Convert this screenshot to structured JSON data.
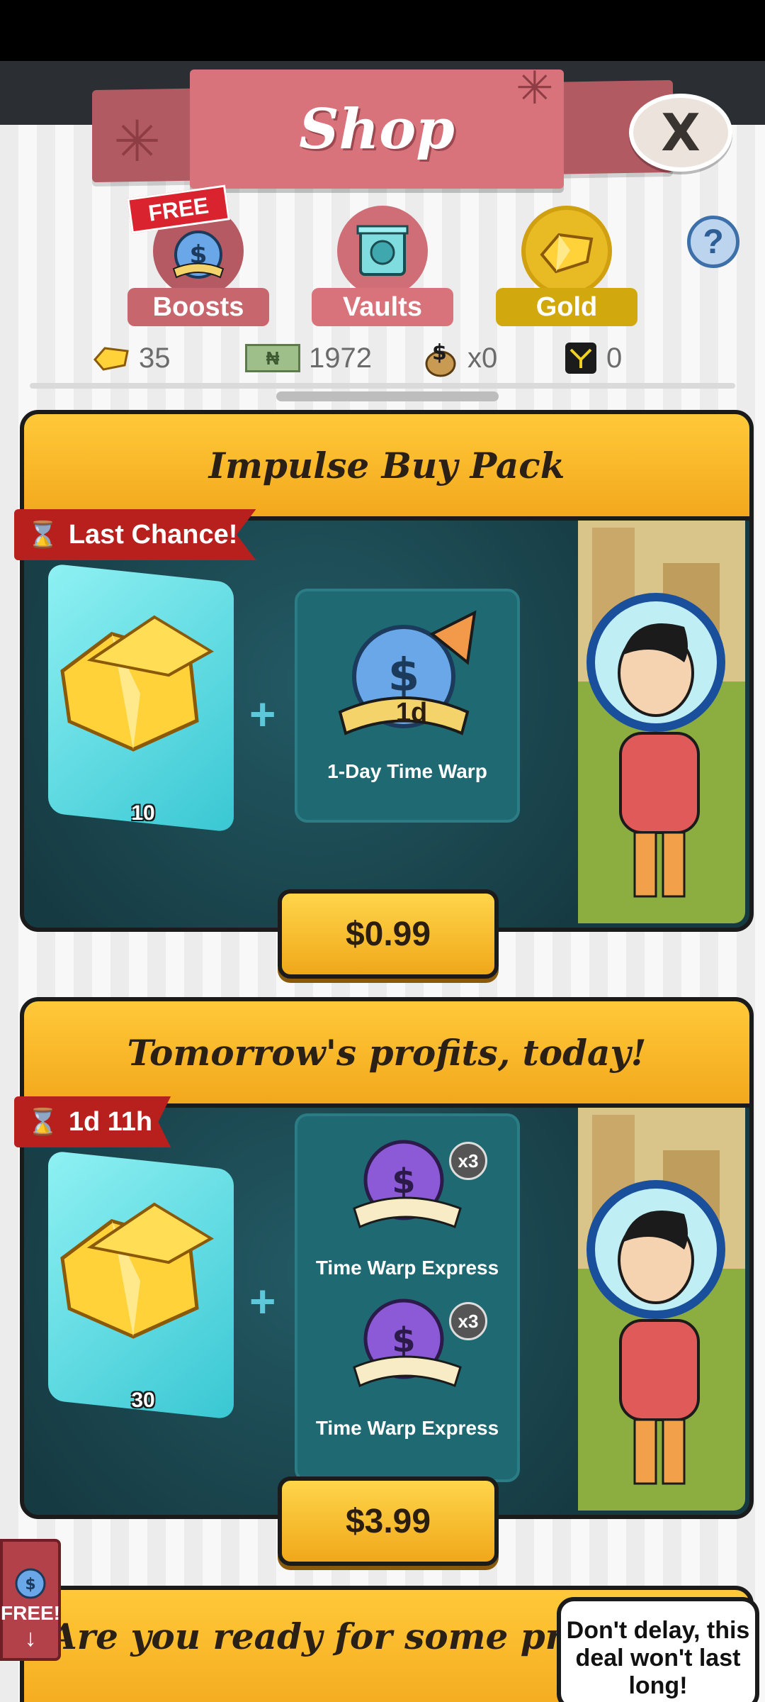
{
  "header": {
    "title": "Shop",
    "close_label": "X",
    "help_label": "?"
  },
  "tabs": [
    {
      "label": "Boosts",
      "ribbon": "FREE"
    },
    {
      "label": "Vaults"
    },
    {
      "label": "Gold",
      "selected": true
    }
  ],
  "currencies": [
    {
      "icon": "gold-icon",
      "value": "35"
    },
    {
      "icon": "cash-icon",
      "note_text": "₦",
      "value": "1972"
    },
    {
      "icon": "money-bag-icon",
      "value": "x0"
    },
    {
      "icon": "megabucks-icon",
      "value": "0"
    }
  ],
  "offers": [
    {
      "title": "Impulse Buy Pack",
      "badge": "Last Chance!",
      "gold_amount": "10",
      "items": [
        {
          "name": "1-Day Time Warp",
          "tag": "1d"
        }
      ],
      "price": "$0.99"
    },
    {
      "title": "Tomorrow's profits, today!",
      "badge": "1d 11h",
      "gold_amount": "30",
      "items": [
        {
          "name": "Time Warp Express",
          "count": "x3"
        },
        {
          "name": "Time Warp Express",
          "count": "x3"
        }
      ],
      "price": "$3.99"
    },
    {
      "title": "Are you ready for some profits?!"
    }
  ],
  "side_button": {
    "label": "FREE!",
    "arrow": "↓"
  },
  "tooltip": {
    "text": "Don't delay, this deal won't last long!"
  },
  "colors": {
    "accent_gold": "#f3a81c",
    "shop_pink": "#d9737b",
    "badge_red": "#b8201e",
    "teal": "#1c4750"
  }
}
